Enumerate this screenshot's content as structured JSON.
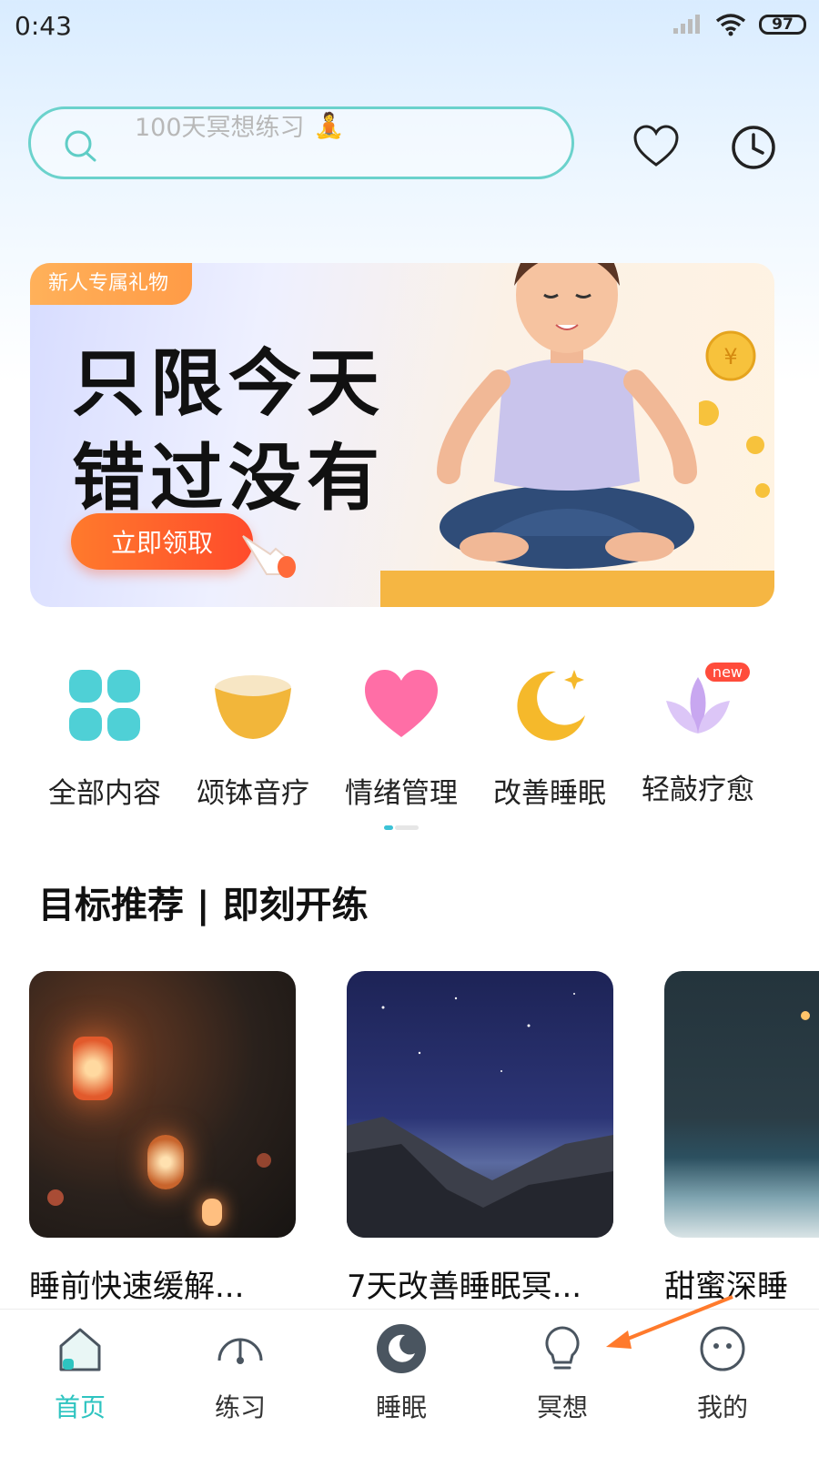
{
  "status": {
    "time": "0:43",
    "battery": "97"
  },
  "search": {
    "placeholder": "100天冥想练习",
    "emoji": "🧘"
  },
  "banner": {
    "tag": "新人专属礼物",
    "line1": "只限今天",
    "line2": "错过没有",
    "button": "立即领取"
  },
  "categories": [
    {
      "label": "全部内容",
      "icon": "four-petal-icon"
    },
    {
      "label": "颂钵音疗",
      "icon": "singing-bowl-icon"
    },
    {
      "label": "情绪管理",
      "icon": "heart-icon"
    },
    {
      "label": "改善睡眠",
      "icon": "moon-icon"
    },
    {
      "label": "轻敲疗愈",
      "icon": "lotus-icon",
      "badge": "new"
    }
  ],
  "section": {
    "title": "目标推荐 | 即刻开练"
  },
  "cards": [
    {
      "title": "睡前快速缓解..."
    },
    {
      "title": "7天改善睡眠冥..."
    },
    {
      "title": "甜蜜深睡"
    }
  ],
  "nav": [
    {
      "label": "首页",
      "active": true
    },
    {
      "label": "练习"
    },
    {
      "label": "睡眠"
    },
    {
      "label": "冥想"
    },
    {
      "label": "我的"
    }
  ],
  "colors": {
    "accent": "#2ec4c0",
    "search_border": "#6bd2cc",
    "banner_button": "#ff5a2b"
  }
}
